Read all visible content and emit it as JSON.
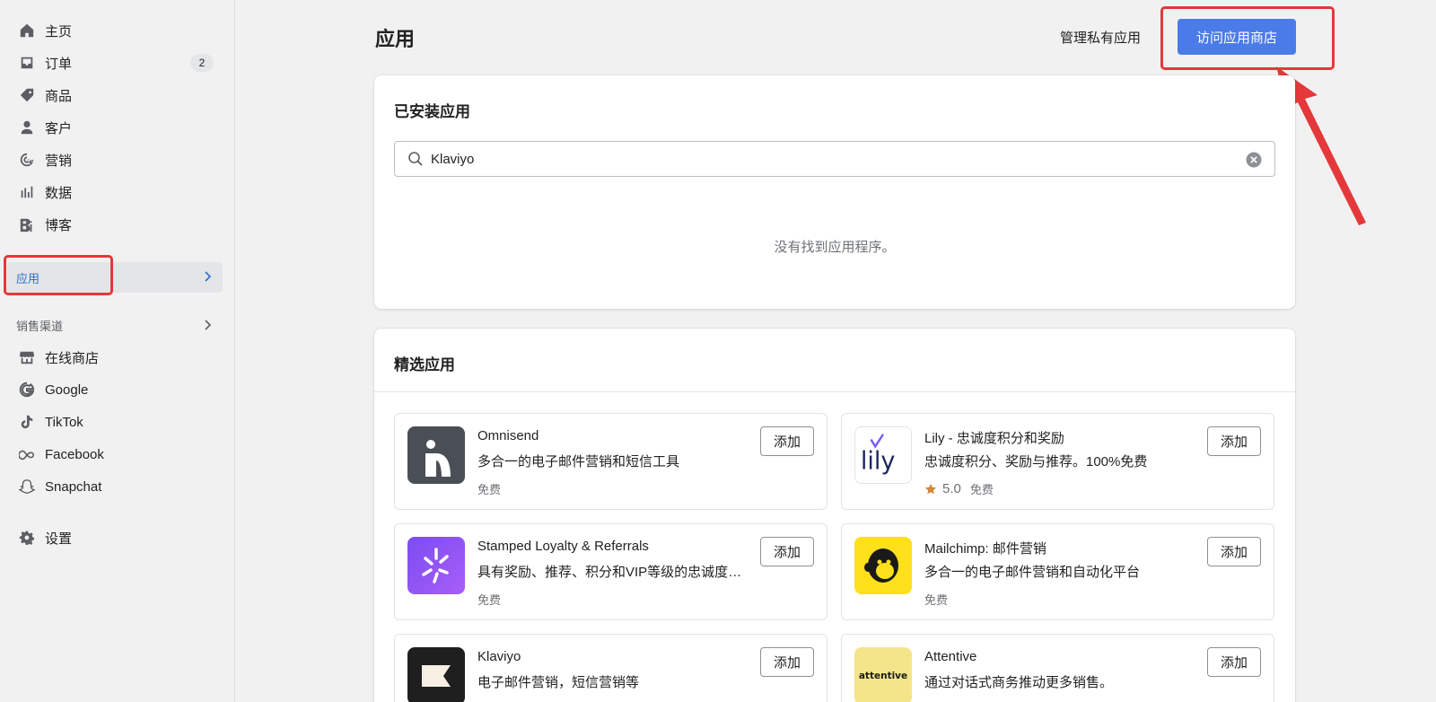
{
  "sidebar": {
    "items": [
      {
        "label": "主页",
        "icon": "home-icon"
      },
      {
        "label": "订单",
        "icon": "orders-icon",
        "badge": "2"
      },
      {
        "label": "商品",
        "icon": "tag-icon"
      },
      {
        "label": "客户",
        "icon": "person-icon"
      },
      {
        "label": "营销",
        "icon": "marketing-icon"
      },
      {
        "label": "数据",
        "icon": "chart-icon"
      },
      {
        "label": "博客",
        "icon": "blog-icon"
      }
    ],
    "active": {
      "label": "应用",
      "icon": "chevron-right-icon"
    },
    "section_label": "销售渠道",
    "channels": [
      {
        "label": "在线商店",
        "icon": "store-icon"
      },
      {
        "label": "Google",
        "icon": "google-icon"
      },
      {
        "label": "TikTok",
        "icon": "tiktok-icon"
      },
      {
        "label": "Facebook",
        "icon": "meta-icon"
      },
      {
        "label": "Snapchat",
        "icon": "snapchat-icon"
      }
    ],
    "settings": {
      "label": "设置",
      "icon": "gear-icon"
    }
  },
  "header": {
    "title": "应用",
    "manage_link": "管理私有应用",
    "store_button": "访问应用商店",
    "accent_color": "#4b7be8",
    "highlight_color": "#e5383b"
  },
  "installed": {
    "title": "已安装应用",
    "search_value": "Klaviyo",
    "empty_message": "没有找到应用程序。"
  },
  "featured": {
    "title": "精选应用",
    "add_label": "添加",
    "apps": [
      {
        "name": "Omnisend",
        "desc": "多合一的电子邮件营销和短信工具",
        "price": "免费",
        "rating": ""
      },
      {
        "name": "Lily - 忠诚度积分和奖励",
        "desc": "忠诚度积分、奖励与推荐。100%免费",
        "price": "免费",
        "rating": "5.0"
      },
      {
        "name": "Stamped Loyalty & Referrals",
        "desc": "具有奖励、推荐、积分和VIP等级的忠诚度计划",
        "price": "免费",
        "rating": ""
      },
      {
        "name": "Mailchimp: 邮件营销",
        "desc": "多合一的电子邮件营销和自动化平台",
        "price": "免费",
        "rating": ""
      },
      {
        "name": "Klaviyo",
        "desc": "电子邮件营销，短信营销等",
        "price": "",
        "rating": ""
      },
      {
        "name": "Attentive",
        "desc": "通过对话式商务推动更多销售。",
        "price": "",
        "rating": "",
        "logo_text": "attentive"
      }
    ]
  }
}
